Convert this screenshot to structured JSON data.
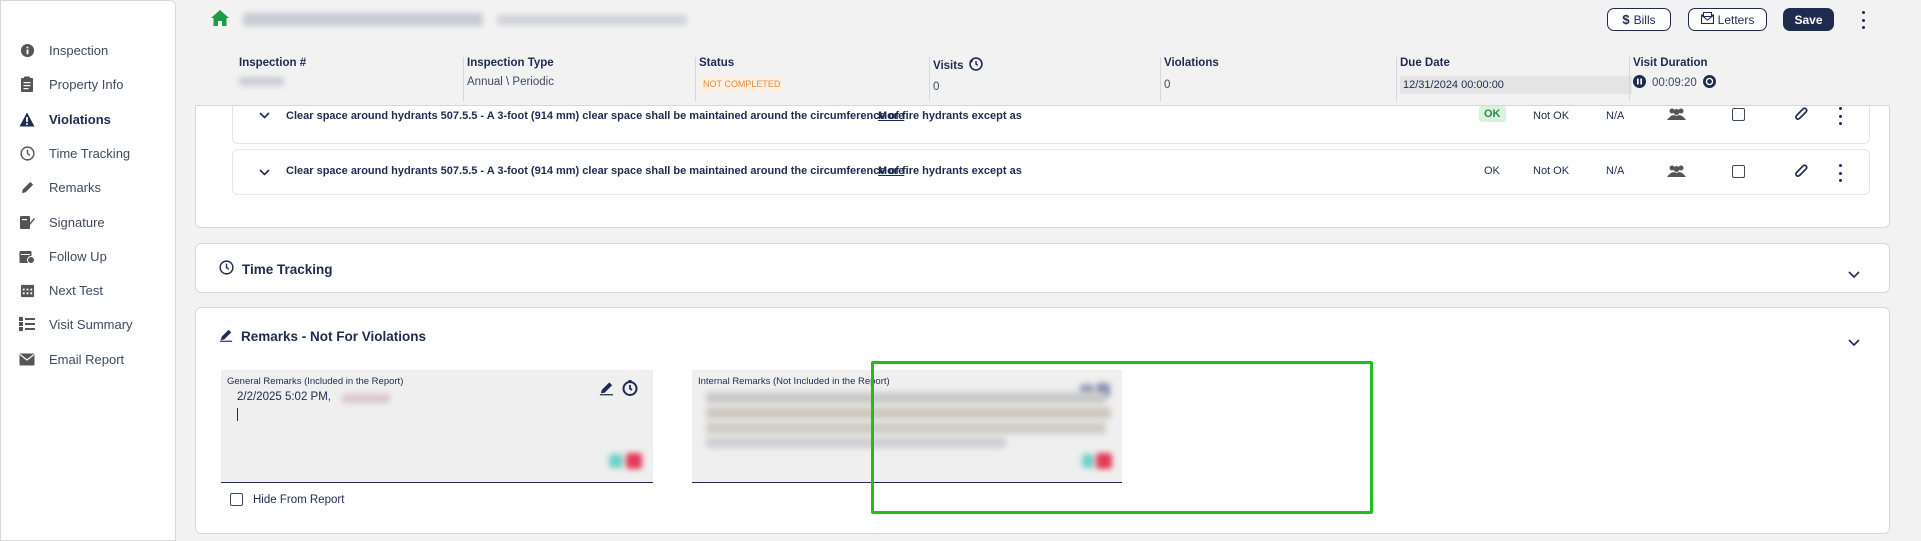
{
  "sidebar": {
    "items": [
      {
        "label": "Inspection",
        "icon": "info-circle-icon",
        "active": false
      },
      {
        "label": "Property Info",
        "icon": "clipboard-icon",
        "active": false
      },
      {
        "label": "Violations",
        "icon": "warning-icon",
        "active": true
      },
      {
        "label": "Time Tracking",
        "icon": "clock-icon",
        "active": false
      },
      {
        "label": "Remarks",
        "icon": "pencil-icon",
        "active": false
      },
      {
        "label": "Signature",
        "icon": "signature-icon",
        "active": false
      },
      {
        "label": "Follow Up",
        "icon": "calendar-clock-icon",
        "active": false
      },
      {
        "label": "Next Test",
        "icon": "calendar-grid-icon",
        "active": false
      },
      {
        "label": "Visit Summary",
        "icon": "list-icon",
        "active": false
      },
      {
        "label": "Email Report",
        "icon": "envelope-icon",
        "active": false
      }
    ]
  },
  "header": {
    "bills_label": "Bills",
    "letters_label": "Letters",
    "save_label": "Save",
    "fields": {
      "inspection_number_label": "Inspection #",
      "inspection_type_label": "Inspection Type",
      "inspection_type_value": "Annual \\ Periodic",
      "status_label": "Status",
      "status_value": "NOT COMPLETED",
      "visits_label": "Visits",
      "visits_value": "0",
      "violations_label": "Violations",
      "violations_value": "0",
      "due_date_label": "Due Date",
      "due_date_value": "12/31/2024 00:00:00",
      "visit_duration_label": "Visit Duration",
      "visit_duration_value": "00:09:20"
    },
    "colors": {
      "accent": "#1d2b4f",
      "home": "#1f9a47",
      "status": "#e8893a"
    }
  },
  "violations": {
    "rows": [
      {
        "text": "Clear space around hydrants 507.5.5 - A 3-foot (914 mm) clear space shall be maintained around the circumference of fire hydrants except as",
        "more": "More",
        "ok": "OK",
        "not_ok": "Not OK",
        "na": "N/A",
        "ok_selected": true
      },
      {
        "text": "Clear space around hydrants 507.5.5 - A 3-foot (914 mm) clear space shall be maintained around the circumference of fire hydrants except as",
        "more": "More",
        "ok": "OK",
        "not_ok": "Not OK",
        "na": "N/A",
        "ok_selected": false
      }
    ]
  },
  "time_tracking": {
    "title": "Time Tracking"
  },
  "remarks": {
    "title": "Remarks - Not For Violations",
    "general_label": "General Remarks (Included in the Report)",
    "general_text": "2/2/2025 5:02 PM,",
    "internal_label": "Internal Remarks (Not Included in the Report)",
    "hide_label": "Hide From Report"
  }
}
